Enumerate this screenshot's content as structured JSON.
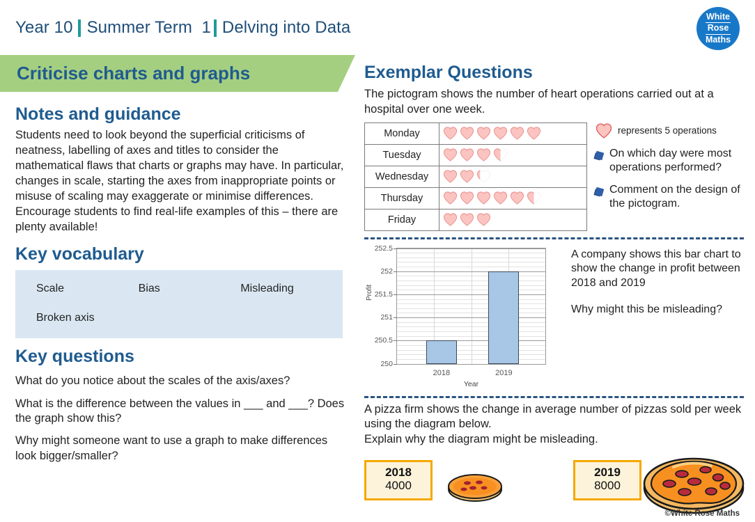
{
  "header": {
    "year": "Year 10",
    "term": "Summer Term  1",
    "unit": "Delving into Data",
    "logo": {
      "line1": "White",
      "line2": "Rose",
      "line3": "Maths"
    }
  },
  "banner": {
    "title": "Criticise charts and graphs"
  },
  "notes": {
    "heading": "Notes and guidance",
    "body": "Students need to look beyond the superficial criticisms of neatness, labelling of axes and titles to consider the mathematical flaws that charts or graphs may have. In particular, changes in scale, starting the axes from inappropriate points or misuse of scaling may exaggerate or minimise differences. Encourage students to find real-life examples of this – there are plenty available!"
  },
  "vocabulary": {
    "heading": "Key vocabulary",
    "terms": [
      "Scale",
      "Bias",
      "Misleading",
      "Broken axis"
    ]
  },
  "key_questions": {
    "heading": "Key questions",
    "items": [
      "What do you notice about the scales of the axis/axes?",
      "What is the difference between the values in ___ and ___? Does the graph show this?",
      "Why might someone want to use a graph to make differences look bigger/smaller?"
    ]
  },
  "exemplar": {
    "heading": "Exemplar Questions",
    "pictogram_intro": "The pictogram shows the number of heart operations carried out at a hospital over one week.",
    "pictogram": {
      "rows": [
        {
          "day": "Monday",
          "full": 6,
          "partial": 0
        },
        {
          "day": "Tuesday",
          "full": 3,
          "partial": 0.5
        },
        {
          "day": "Wednesday",
          "full": 2,
          "partial": 0.25
        },
        {
          "day": "Thursday",
          "full": 5,
          "partial": 0.5
        },
        {
          "day": "Friday",
          "full": 3,
          "partial": 0
        }
      ]
    },
    "key_text": "represents 5 operations",
    "questions": [
      "On which day were most operations performed?",
      "Comment on the design of the pictogram."
    ],
    "chart_text_1": "A company shows this bar chart to show the change in profit between 2018 and 2019",
    "chart_text_2": "Why might this be misleading?",
    "pizza_intro_line1": "A pizza firm shows the change in average number of pizzas sold per week using the diagram below.",
    "pizza_intro_line2": "Explain why the diagram might be misleading.",
    "pizza": [
      {
        "year": "2018",
        "value": "4000"
      },
      {
        "year": "2019",
        "value": "8000"
      }
    ]
  },
  "copyright": "©White Rose Maths",
  "colors": {
    "navy": "#1f5b8f",
    "green_banner": "#a5cf80",
    "teal": "#1f9b9b",
    "vocab_bg": "#dae7f2",
    "bar_fill": "#a8c6e5",
    "gold": "#f5a800",
    "heart_fill": "#fbc4c1",
    "logo_blue": "#1878c8"
  },
  "chart_data": {
    "type": "bar",
    "title": "",
    "categories": [
      "2018",
      "2019"
    ],
    "values": [
      250.5,
      252
    ],
    "series": [
      {
        "name": "Profit",
        "values": [
          250.5,
          252
        ]
      }
    ],
    "xlabel": "Year",
    "ylabel": "Profit",
    "ylim": [
      250,
      252.5
    ],
    "ytick_labels": [
      "250",
      "250.5",
      "251",
      "251.5",
      "252",
      "252.5"
    ],
    "ytick_values": [
      250,
      250.5,
      251,
      251.5,
      252,
      252.5
    ],
    "minor_tick_step": 0.1,
    "grid": true,
    "legend": "none"
  }
}
